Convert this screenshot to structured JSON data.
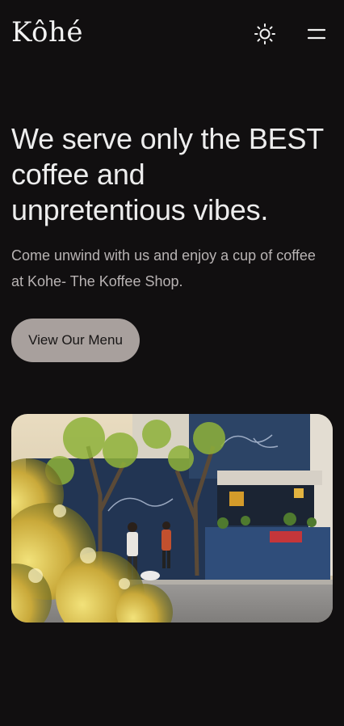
{
  "header": {
    "logo": "Kôhé",
    "theme_toggle_icon": "sun-icon",
    "menu_icon": "hamburger-menu-icon"
  },
  "hero": {
    "headline_line1": "We serve only the BEST",
    "headline_line2": "coffee and",
    "headline_line3": "unpretentious vibes.",
    "subtext": "Come unwind with us and enjoy a cup of coffee at Kohe- The Koffee Shop.",
    "cta_label": "View Our Menu"
  },
  "photo": {
    "description_icon": "storefront-photo"
  },
  "colors": {
    "background": "#110f10",
    "text": "#ececec",
    "muted_text": "#b8b3b3",
    "cta_bg": "#a8a09d"
  }
}
